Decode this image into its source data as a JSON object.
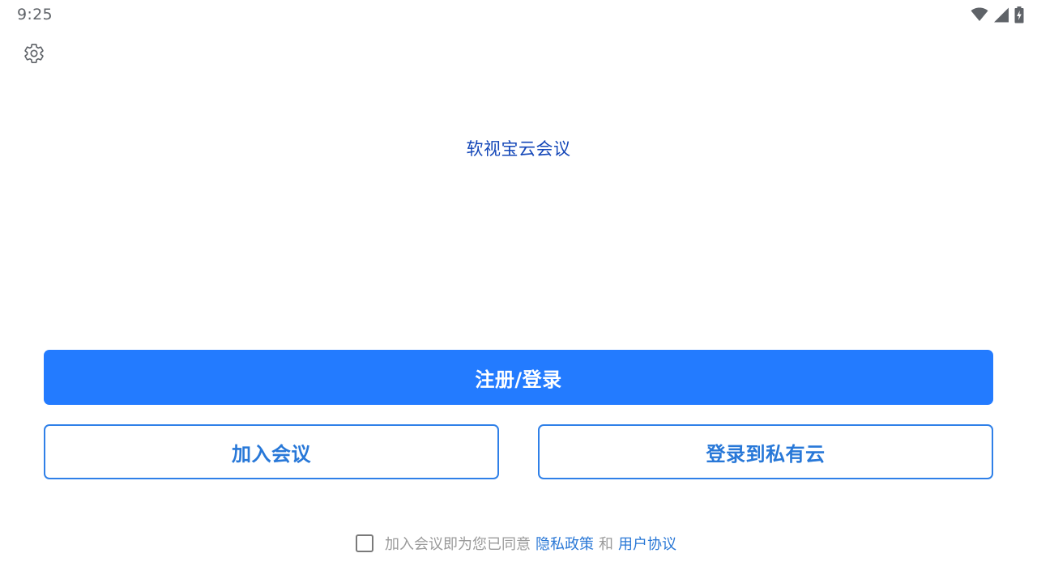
{
  "status_bar": {
    "time": "9:25",
    "icons": [
      "wifi-icon",
      "signal-icon",
      "battery-charging-icon"
    ]
  },
  "settings": {
    "icon": "gear-icon"
  },
  "app": {
    "title": "软视宝云会议"
  },
  "actions": {
    "register_login": "注册/登录",
    "join_meeting": "加入会议",
    "login_private_cloud": "登录到私有云"
  },
  "agreement": {
    "checked": false,
    "prefix": "加入会议即为您已同意",
    "privacy_policy": "隐私政策",
    "and": "和",
    "user_agreement": "用户协议"
  },
  "colors": {
    "primary": "#237bff",
    "outline": "#2f80e8",
    "title": "#1447b8",
    "link": "#2a78d6",
    "muted": "#9a9a9a"
  }
}
